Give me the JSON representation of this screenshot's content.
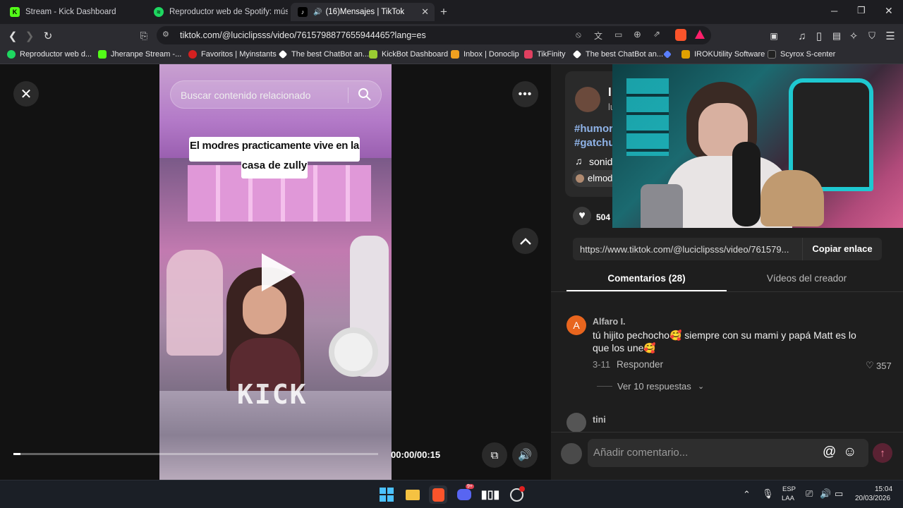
{
  "tabs": [
    {
      "title": "Stream - Kick Dashboard",
      "favicon_color": "#53fc18",
      "favicon_glyph": "K"
    },
    {
      "title": "Reproductor web de Spotify: música pa",
      "favicon_color": "#1ed760",
      "favicon_glyph": "≈"
    },
    {
      "title": "(16)Mensajes | TikTok",
      "favicon_color": "#000000",
      "favicon_glyph": "♪",
      "audio": "🔊"
    }
  ],
  "new_tab_glyph": "+",
  "url": "tiktok.com/@luciclipsss/video/7615798877655944465?lang=es",
  "bookmarks": [
    {
      "label": "Reproductor web d...",
      "color": "#1ed760"
    },
    {
      "label": "Jheranpe Stream -...",
      "color": "#53fc18"
    },
    {
      "label": "Favoritos | Myinstants",
      "color": "#d42020"
    },
    {
      "label": "The best ChatBot an...",
      "color": "#ffffff"
    },
    {
      "label": "KickBot Dashboard",
      "color": "#9acd32"
    },
    {
      "label": "Inbox | Donoclip",
      "color": "#f0a020"
    },
    {
      "label": "TikFinity",
      "color": "#e04060"
    },
    {
      "label": "The best ChatBot an...",
      "color": "#ffffff"
    },
    {
      "label": "",
      "color": "#5a7fff"
    },
    {
      "label": "IROKUtility Software",
      "color": "#e0a000"
    },
    {
      "label": "Scyrox S-center",
      "color": "#222222"
    }
  ],
  "video": {
    "search_placeholder": "Buscar contenido relacionado",
    "caption_line1": "El modres practicamente vive en la",
    "caption_line2": "casa de zully",
    "watermark": "KICK",
    "time": "00:00/00:15",
    "progress": 0.02
  },
  "creator": {
    "name_partial": "l",
    "handle_partial": "lu",
    "hashtags": [
      "#humor",
      "#gatchu"
    ],
    "sound_partial": "sonid",
    "mention_partial": "elmod",
    "likes_partial": "504"
  },
  "share": {
    "link": "https://www.tiktok.com/@luciclipsss/video/761579...",
    "copy_label": "Copiar enlace"
  },
  "tabs_panel": {
    "comments_tab": "Comentarios (28)",
    "videos_tab": "Vídeos del creador"
  },
  "comments": [
    {
      "avatar_letter": "A",
      "user": "Alfaro I.",
      "text": "tú hijito pechocho🥰 siempre con su mami y papá Matt es lo que los une🥰",
      "date": "3-11",
      "reply": "Responder",
      "likes": "357",
      "replies_label": "Ver 10 respuestas"
    },
    {
      "user": "tini"
    }
  ],
  "comment_input_placeholder": "Añadir comentario...",
  "taskbar": {
    "lang_top": "ESP",
    "lang_bottom": "LAA",
    "time": "15:04",
    "date": "20/03/2026",
    "discord_badge": "9+"
  },
  "colors": {
    "tiktok_red": "#fe2c55",
    "kick_green": "#53fc18"
  }
}
